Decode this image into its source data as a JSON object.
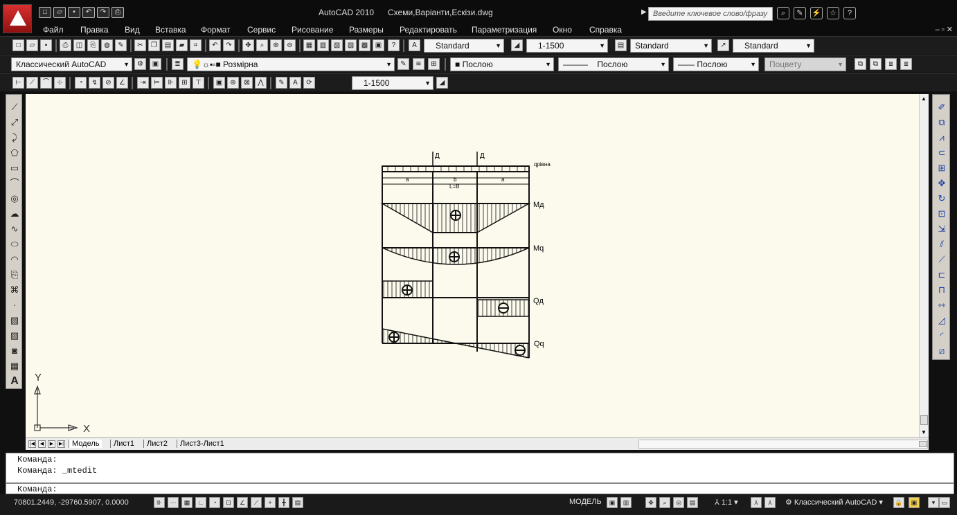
{
  "app": {
    "title": "AutoCAD 2010",
    "document": "Схеми,Варіанти,Ескізи.dwg"
  },
  "search": {
    "placeholder": "Введите ключевое слово/фразу"
  },
  "menu": [
    "Файл",
    "Правка",
    "Вид",
    "Вставка",
    "Формат",
    "Сервис",
    "Рисование",
    "Размеры",
    "Редактировать",
    "Параметризация",
    "Окно",
    "Справка"
  ],
  "styles_toolbar": {
    "text_style": "Standard",
    "dim_style": "1-1500",
    "table_style": "Standard",
    "mleader_style": "Standard"
  },
  "layers_toolbar": {
    "workspace": "Классический AutoCAD",
    "layer": "Розмірна",
    "color": "Послою",
    "linetype": "Послою",
    "lineweight": "Послою",
    "plotstyle": "Поцвету"
  },
  "dim_toolbar": {
    "dim_style": "1-1500"
  },
  "drawing": {
    "load_labels": [
      "Д",
      "Д"
    ],
    "q_label": "qрівна",
    "span_labels": [
      "a",
      "b",
      "a"
    ],
    "total_span": "L=B",
    "diagram_labels": [
      "Mд",
      "Mq",
      "Qд",
      "Qq"
    ],
    "signs": {
      "plus": "⊕",
      "minus": "⊖"
    }
  },
  "ucs": {
    "x": "X",
    "y": "Y"
  },
  "tabs": [
    "Модель",
    "Лист1",
    "Лист2",
    "Лист3-Лист1"
  ],
  "command": {
    "lines": [
      "Команда:",
      "Команда:  _mtedit"
    ],
    "prompt": "Команда:"
  },
  "status": {
    "coords": "70801.2449, -29760.5907, 0.0000",
    "model": "МОДЕЛЬ",
    "scale": "1:1",
    "workspace": "Классический AutoCAD"
  }
}
